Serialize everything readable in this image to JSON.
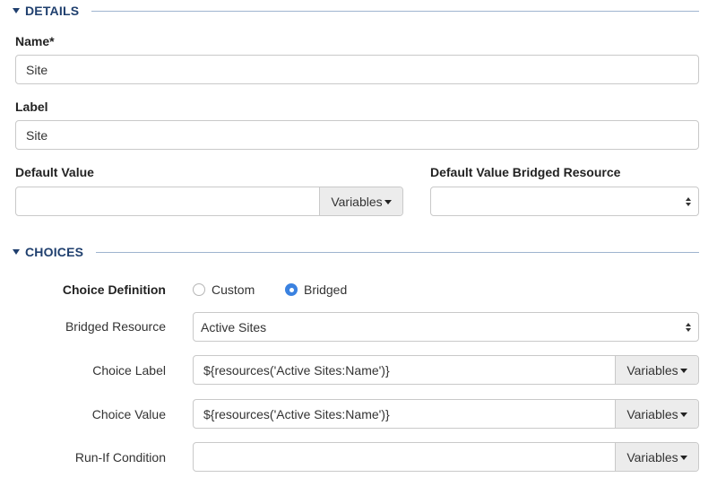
{
  "details": {
    "title": "DETAILS",
    "name_label": "Name*",
    "name_value": "Site",
    "label_label": "Label",
    "label_value": "Site",
    "default_value_label": "Default Value",
    "default_value_value": "",
    "variables_label": "Variables",
    "bridged_resource_label": "Default Value Bridged Resource",
    "bridged_resource_value": ""
  },
  "choices": {
    "title": "CHOICES",
    "choice_definition_label": "Choice Definition",
    "options": [
      {
        "label": "Custom",
        "selected": false
      },
      {
        "label": "Bridged",
        "selected": true
      }
    ],
    "bridged_resource_label": "Bridged Resource",
    "bridged_resource_value": "Active Sites",
    "choice_label_label": "Choice Label",
    "choice_label_value": "${resources('Active Sites:Name')}",
    "choice_value_label": "Choice Value",
    "choice_value_value": "${resources('Active Sites:Name')}",
    "run_if_label": "Run-If Condition",
    "run_if_value": "",
    "variables_label": "Variables"
  },
  "colors": {
    "section_title": "#1f3f6e",
    "radio_selected": "#3b82e0",
    "button_bg": "#ececec"
  }
}
